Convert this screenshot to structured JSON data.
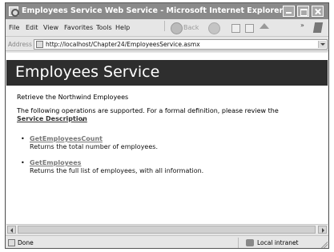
{
  "window": {
    "title": "Employees Service Web Service - Microsoft Internet Explorer"
  },
  "menu": {
    "items": [
      "File",
      "Edit",
      "View",
      "Favorites",
      "Tools",
      "Help"
    ],
    "back_label": "Back",
    "overflow": "»"
  },
  "address": {
    "label": "Address",
    "url": "http://localhost/Chapter24/EmployeesService.asmx"
  },
  "page": {
    "header": "Employees Service",
    "intro": "Retrieve the Northwind Employees",
    "ops_text": "The following operations are supported. For a formal definition, please review the",
    "service_description": "Service Description",
    "operations": [
      {
        "name": "GetEmployeesCount",
        "desc": "Returns the total number of employees."
      },
      {
        "name": "GetEmployees",
        "desc": "Returns the full list of employees, with all information."
      }
    ],
    "bullet": "•"
  },
  "status": {
    "text": "Done",
    "zone": "Local intranet"
  },
  "colors": {
    "header_band": "#2e2e2e",
    "title_bar": "#8a8a8a",
    "link": "#777777"
  }
}
